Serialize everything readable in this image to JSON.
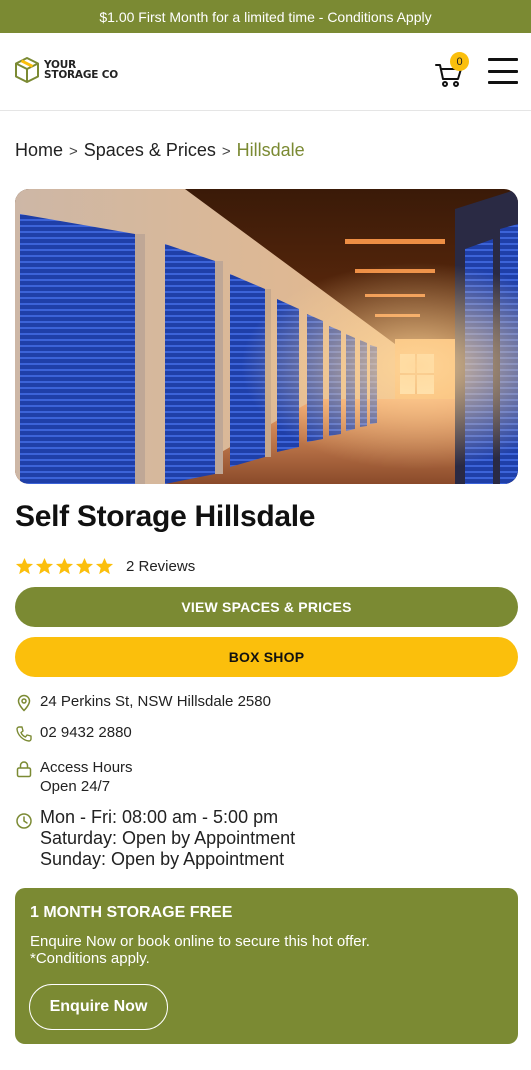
{
  "promo": {
    "text": "$1.00 First Month for a limited time - Conditions Apply"
  },
  "header": {
    "logo_line1": "YOUR",
    "logo_line2": "STORAGE CO",
    "cart_count": "0"
  },
  "breadcrumb": {
    "items": [
      "Home",
      "Spaces & Prices"
    ],
    "current": "Hillsdale",
    "separator": ">"
  },
  "hero": {
    "image": "storage-corridor-photo"
  },
  "title": "Self Storage Hillsdale",
  "rating": {
    "stars": 5,
    "reviews_label": "2 Reviews"
  },
  "buttons": {
    "spaces": "VIEW SPACES & PRICES",
    "box_shop": "BOX SHOP"
  },
  "info": {
    "address": "24 Perkins St, NSW Hillsdale 2580",
    "phone": "02 9432 2880",
    "access_label": "Access Hours",
    "access_value": "Open 24/7",
    "hours": [
      "Mon - Fri: 08:00 am - 5:00 pm",
      "Saturday: Open by Appointment",
      "Sunday: Open by Appointment"
    ]
  },
  "offer": {
    "title": "1 MONTH STORAGE FREE",
    "line1": "Enquire Now or book online to secure this hot offer.",
    "line2": "*Conditions apply.",
    "button": "Enquire Now"
  },
  "colors": {
    "brand_green": "#7b8a33",
    "brand_yellow": "#fbbf0c"
  }
}
